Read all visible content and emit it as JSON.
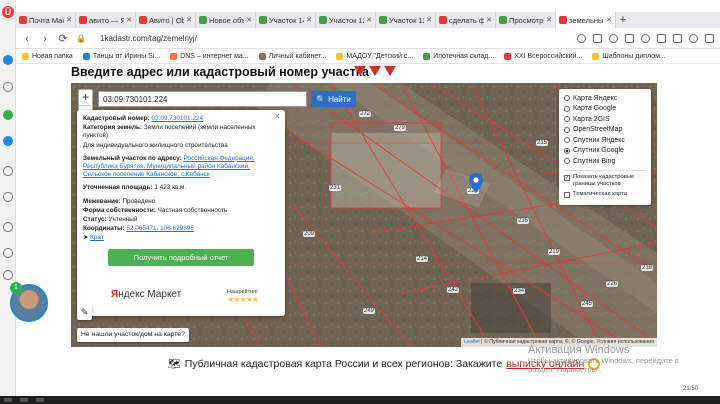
{
  "browser": {
    "tabs": [
      {
        "label": "Почта Mai",
        "color": "#e53935",
        "active": false
      },
      {
        "label": "авито — Я",
        "color": "#e53935",
        "active": false
      },
      {
        "label": "Авито | Ob",
        "color": "#e53935",
        "active": false
      },
      {
        "label": "Новое объ",
        "color": "#43a047",
        "active": false
      },
      {
        "label": "Участок 14",
        "color": "#43a047",
        "active": false
      },
      {
        "label": "Участок 12",
        "color": "#43a047",
        "active": false
      },
      {
        "label": "Участок 12",
        "color": "#43a047",
        "active": false
      },
      {
        "label": "сделать ф",
        "color": "#e53935",
        "active": false
      },
      {
        "label": "Просмотр",
        "color": "#43a047",
        "active": false
      },
      {
        "label": "земельны",
        "color": "#e53935",
        "active": true
      }
    ],
    "new_tab": "+",
    "url": "1kadastr.com/tag/zemelnyj/",
    "bookmarks": [
      {
        "label": "Новая папка",
        "color": "#fbc02d"
      },
      {
        "label": "Танцы от Ирины Si...",
        "color": "#1e88e5"
      },
      {
        "label": "DNS – интернет ма...",
        "color": "#ff7043"
      },
      {
        "label": "Личный кабинет...",
        "color": "#8d6e63"
      },
      {
        "label": "МАДОУ \"Детский с...",
        "color": "#fbc02d"
      },
      {
        "label": "Ипотечная склад...",
        "color": "#43a047"
      },
      {
        "label": "XXI Всероссийский...",
        "color": "#e53935"
      },
      {
        "label": "Шаблоны диплом...",
        "color": "#fbc02d"
      }
    ]
  },
  "page": {
    "heading": "Введите адрес или кадастровый номер участка",
    "search_value": "03:09:730101:224",
    "find_button": "Найти",
    "popup": {
      "close": "×",
      "cadnum_label": "Кадастровый номер:",
      "cadnum_value": "03:09:730101:224",
      "category_label": "Категория земель:",
      "category_value": "Земли поселений (земли населенных пунктов)",
      "use": "Для индивидуального жилищного строительства",
      "address_label": "Земельный участок по адресу:",
      "address_value": "Российская Федерация, Республика Бурятия, Муниципальный район Кабанский, Сельское поселение Кабанское, с.Кабанск",
      "area_label": "Уточненная площадь:",
      "area_value": "1 423 кв.м.",
      "survey_label": "Межевание:",
      "survey_value": "Проведено",
      "ownership_label": "Форма собственности:",
      "ownership_value": "Частная собственность",
      "status_label": "Статус:",
      "status_value": "Учтенный",
      "coords_label": "Координаты:",
      "coords_value": "52.065471, 106.629896",
      "more_link": "Крат",
      "detail_button": "Получить подробный отчет",
      "market_brand_y": "Я",
      "market_brand_rest": "ндекс Маркет",
      "rating_label": "Нашрейтинг",
      "rating_stars": "★★★★★"
    },
    "not_found": "Не нашли участок/дом на карте?",
    "layers": {
      "options": [
        {
          "label": "Карта Яндекс",
          "selected": false
        },
        {
          "label": "Карта Google",
          "selected": false
        },
        {
          "label": "Карта 2GIS",
          "selected": false
        },
        {
          "label": "OpenStreetMap",
          "selected": false
        },
        {
          "label": "Спутник Яндекс",
          "selected": false
        },
        {
          "label": "Спутник Google",
          "selected": true
        },
        {
          "label": "Спутник Bing",
          "selected": false
        }
      ],
      "show_borders": "Показать кадастровые границы участков",
      "thematic": "Тематическая карта"
    },
    "plot_labels": [
      "272",
      "279",
      "215",
      "231",
      "224",
      "235",
      "214",
      "209",
      "219",
      "242",
      "234",
      "218",
      "226",
      "245",
      "249"
    ],
    "attribution_leaflet": "Leaflet",
    "attribution_rest": " | © Публичная кадастровая карта, ©, © Google, Условия использования",
    "promo_text": "Публичная кадастровая карта России и всех регионов: Закажите",
    "promo_link": "выписку онлайн",
    "watermark_title": "Активация Windows",
    "watermark_sub": "Чтобы активировать Windows, перейдите в раздел \"Параметры\".",
    "badge_count": "1",
    "clock": "21:50"
  },
  "colors": {
    "accent": "#2a6fc9",
    "green_button": "#4caf50",
    "cadastral_lines": "#e53935"
  }
}
